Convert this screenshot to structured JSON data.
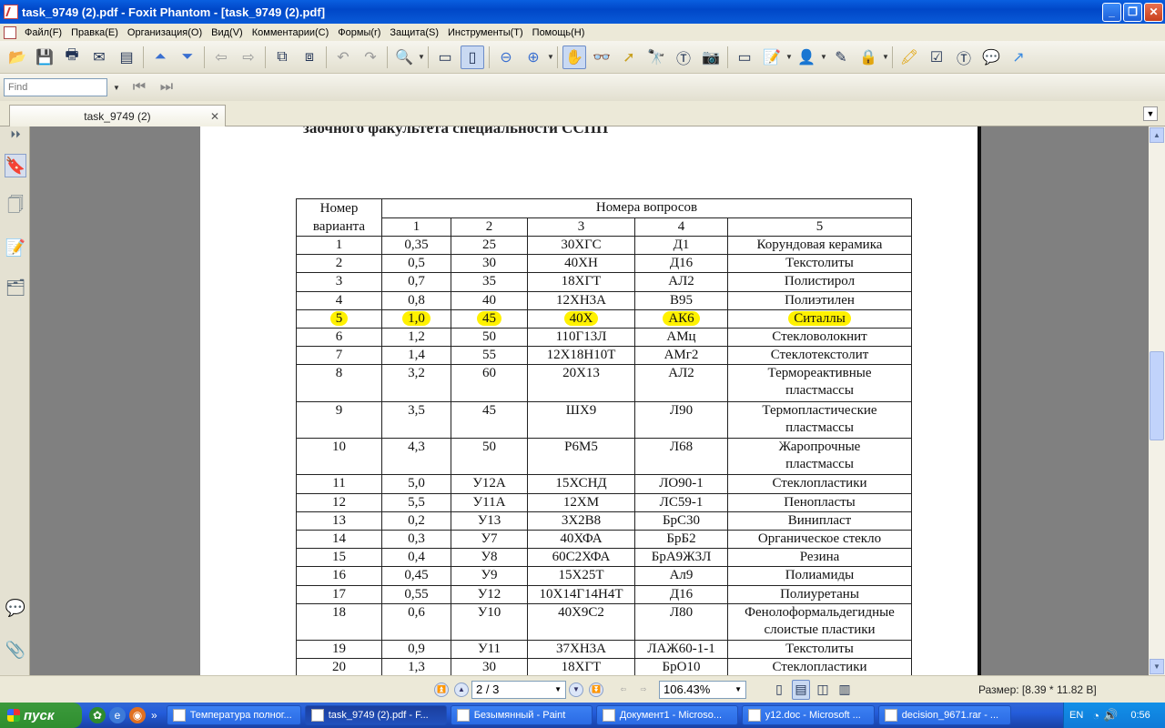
{
  "window": {
    "title": "task_9749 (2).pdf - Foxit Phantom - [task_9749 (2).pdf]"
  },
  "menu": [
    "Файл(F)",
    "Правка(E)",
    "Организация(O)",
    "Вид(V)",
    "Комментарии(C)",
    "Формы(r)",
    "Защита(S)",
    "Инструменты(T)",
    "Помощь(H)"
  ],
  "find": {
    "placeholder": "Find"
  },
  "tab": {
    "label": "task_9749 (2)"
  },
  "document": {
    "heading": "заочного факультета специальности ССПП",
    "table": {
      "header_variant_line1": "Номер",
      "header_variant_line2": "варианта",
      "header_questions": "Номера вопросов",
      "question_cols": [
        "1",
        "2",
        "3",
        "4",
        "5"
      ],
      "highlighted_variant": "5",
      "rows": [
        [
          "1",
          "0,35",
          "25",
          "30ХГС",
          "Д1",
          "Корундовая керамика"
        ],
        [
          "2",
          "0,5",
          "30",
          "40ХН",
          "Д16",
          "Текстолиты"
        ],
        [
          "3",
          "0,7",
          "35",
          "18ХГТ",
          "АЛ2",
          "Полистирол"
        ],
        [
          "4",
          "0,8",
          "40",
          "12ХН3А",
          "В95",
          "Полиэтилен"
        ],
        [
          "5",
          "1,0",
          "45",
          "40Х",
          "АК6",
          "Ситаллы"
        ],
        [
          "6",
          "1,2",
          "50",
          "110Г13Л",
          "АМц",
          "Стекловолокнит"
        ],
        [
          "7",
          "1,4",
          "55",
          "12Х18Н10Т",
          "АМг2",
          "Стеклотекстолит"
        ],
        [
          "8",
          "3,2",
          "60",
          "20Х13",
          "АЛ2",
          "Термореактивные\nпластмассы"
        ],
        [
          "9",
          "3,5",
          "45",
          "ШХ9",
          "Л90",
          "Термопластические\nпластмассы"
        ],
        [
          "10",
          "4,3",
          "50",
          "Р6М5",
          "Л68",
          "Жаропрочные\nпластмассы"
        ],
        [
          "11",
          "5,0",
          "У12А",
          "15ХСНД",
          "ЛО90-1",
          "Стеклопластики"
        ],
        [
          "12",
          "5,5",
          "У11А",
          "12ХМ",
          "ЛС59-1",
          "Пенопласты"
        ],
        [
          "13",
          "0,2",
          "У13",
          "3Х2В8",
          "БрС30",
          "Винипласт"
        ],
        [
          "14",
          "0,3",
          "У7",
          "40ХФА",
          "БрБ2",
          "Органическое стекло"
        ],
        [
          "15",
          "0,4",
          "У8",
          "60С2ХФА",
          "БрА9Ж3Л",
          "Резина"
        ],
        [
          "16",
          "0,45",
          "У9",
          "15Х25Т",
          "Ал9",
          "Полиамиды"
        ],
        [
          "17",
          "0,55",
          "У12",
          "10Х14Г14Н4Т",
          "Д16",
          "Полиуретаны"
        ],
        [
          "18",
          "0,6",
          "У10",
          "40Х9С2",
          "Л80",
          "Фенолоформальдегидные\nслоистые пластики"
        ],
        [
          "19",
          "0,9",
          "У11",
          "37ХН3А",
          "ЛАЖ60-1-1",
          "Текстолиты"
        ],
        [
          "20",
          "1,3",
          "30",
          "18ХГТ",
          "БрО10",
          "Стеклопластики"
        ]
      ]
    }
  },
  "status": {
    "page": "2 / 3",
    "zoom": "106.43%",
    "size": "Размер: [8.39 * 11.82 В]"
  },
  "taskbar": {
    "start": "пуск",
    "tasks": [
      {
        "label": "Температура полног...",
        "active": false
      },
      {
        "label": "task_9749 (2).pdf - F...",
        "active": true
      },
      {
        "label": "Безымянный - Paint",
        "active": false
      },
      {
        "label": "Документ1 - Microso...",
        "active": false
      },
      {
        "label": "y12.doc - Microsoft ...",
        "active": false
      },
      {
        "label": "decision_9671.rar - ...",
        "active": false
      }
    ],
    "lang": "EN",
    "clock": "0:56"
  },
  "colors": {
    "highlight": "#FFF100",
    "titlebar": "#0A5FE0",
    "taskbar": "#245DDB"
  }
}
